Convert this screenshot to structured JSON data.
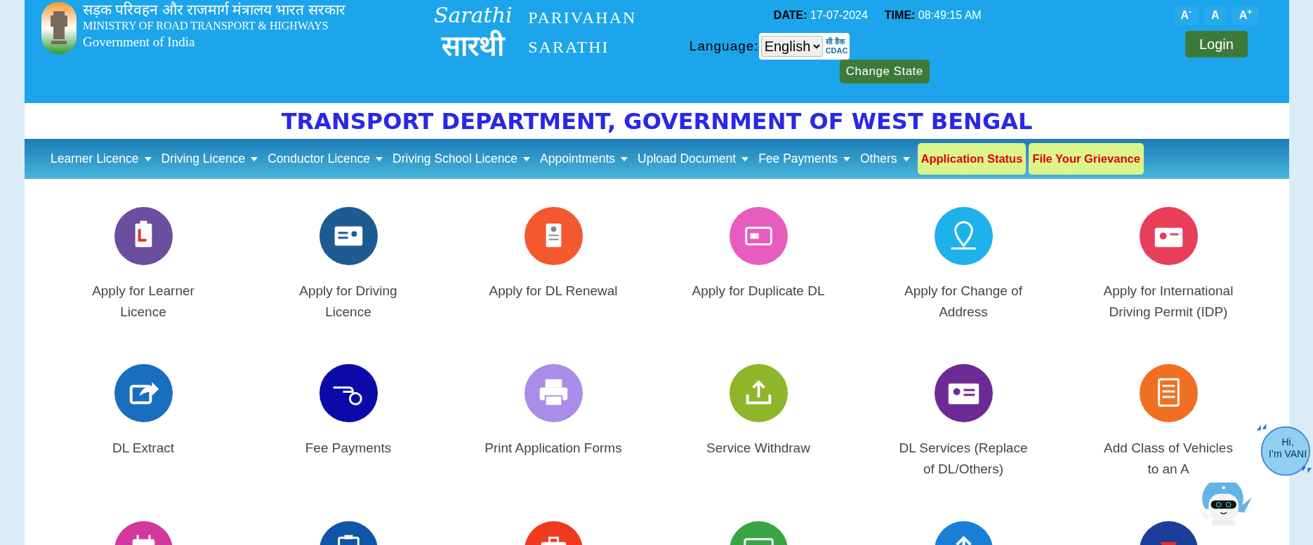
{
  "header": {
    "ministry_hindi": "सड़क परिवहन और राजमार्ग मंत्रालय भारत सरकार",
    "ministry": "MINISTRY OF ROAD TRANSPORT & HIGHWAYS",
    "government": "Government of India",
    "logo_text": "Sarathi",
    "logo_hindi": "सारथी",
    "portal_line1": "PARIVAHAN",
    "portal_line2": "SARATHI",
    "date_label": "DATE:",
    "date": "17-07-2024",
    "time_label": "TIME:",
    "time": "08:49:15 AM",
    "language_label": "Language:",
    "language": "English",
    "cdac_hindi": "सी डैक",
    "cdac": "CDAC",
    "change_state": "Change State",
    "font_buttons": [
      "A$^{-}$",
      "A",
      "A$^{+}$"
    ],
    "login": "Login"
  },
  "department_title": "TRANSPORT DEPARTMENT, GOVERNMENT OF WEST BENGAL",
  "nav": [
    {
      "label": "Learner Licence",
      "kind": "dropdown"
    },
    {
      "label": "Driving Licence",
      "kind": "dropdown"
    },
    {
      "label": "Conductor Licence",
      "kind": "dropdown"
    },
    {
      "label": "Driving School Licence",
      "kind": "dropdown"
    },
    {
      "label": "Appointments",
      "kind": "dropdown"
    },
    {
      "label": "Upload Document",
      "kind": "dropdown"
    },
    {
      "label": "Fee Payments",
      "kind": "dropdown"
    },
    {
      "label": "Others",
      "kind": "dropdown"
    },
    {
      "label": "Application Status",
      "kind": "highlight"
    },
    {
      "label": "File Your Grievance",
      "kind": "highlight"
    }
  ],
  "services": [
    {
      "label": "Apply for Learner Licence",
      "color": "#6a4f9e"
    },
    {
      "label": "Apply for Driving Licence",
      "color": "#1e5b91"
    },
    {
      "label": "Apply for DL Renewal",
      "color": "#f4582f"
    },
    {
      "label": "Apply for Duplicate DL",
      "color": "#e75dbf"
    },
    {
      "label": "Apply for Change of Address",
      "color": "#1eb1ea"
    },
    {
      "label": "Apply for International Driving Permit (IDP)",
      "color": "#e83e5a"
    },
    {
      "label": "DL Extract",
      "color": "#1a6ec0"
    },
    {
      "label": "Fee Payments",
      "color": "#0a0aa8"
    },
    {
      "label": "Print Application Forms",
      "color": "#a98de8"
    },
    {
      "label": "Service Withdraw",
      "color": "#8fb52a"
    },
    {
      "label": "DL Services (Replace of DL/Others)",
      "color": "#6d2a94"
    },
    {
      "label": "Add Class of Vehicles to an A",
      "color": "#f07022"
    },
    {
      "color": "#d1399c"
    },
    {
      "color": "#1155a8"
    },
    {
      "color": "#f03a1f"
    },
    {
      "color": "#3aa545"
    },
    {
      "color": "#1a7fd6"
    },
    {
      "color": "#1c3d9a"
    }
  ],
  "chatbot": {
    "greeting_line1": "Hi,",
    "greeting_line2": "I’m VANI"
  }
}
